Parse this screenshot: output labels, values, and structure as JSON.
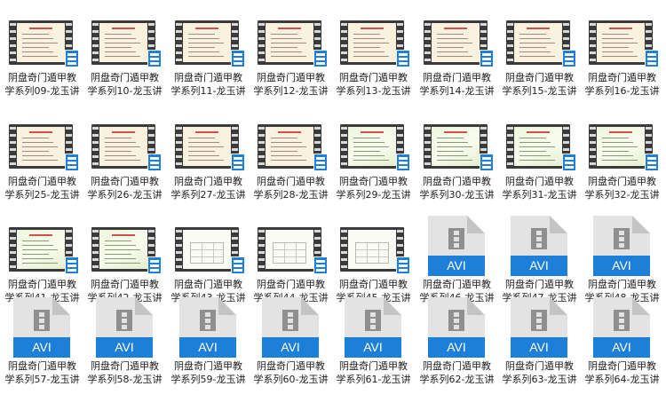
{
  "files": [
    {
      "name": "阴盘奇门遁甲教\n学系列09-龙玉讲",
      "type": "video",
      "style": "warm"
    },
    {
      "name": "阴盘奇门遁甲教\n学系列10-龙玉讲",
      "type": "video",
      "style": "warm"
    },
    {
      "name": "阴盘奇门遁甲教\n学系列11-龙玉讲",
      "type": "video",
      "style": "warm"
    },
    {
      "name": "阴盘奇门遁甲教\n学系列12-龙玉讲",
      "type": "video",
      "style": "warm"
    },
    {
      "name": "阴盘奇门遁甲教\n学系列13-龙玉讲",
      "type": "video",
      "style": "warm"
    },
    {
      "name": "阴盘奇门遁甲教\n学系列14-龙玉讲",
      "type": "video",
      "style": "warm"
    },
    {
      "name": "阴盘奇门遁甲教\n学系列15-龙玉讲",
      "type": "video",
      "style": "warm"
    },
    {
      "name": "阴盘奇门遁甲教\n学系列16-龙玉讲",
      "type": "video",
      "style": "warm"
    },
    {
      "name": "阴盘奇门遁甲教\n学系列25-龙玉讲",
      "type": "video",
      "style": "warm"
    },
    {
      "name": "阴盘奇门遁甲教\n学系列26-龙玉讲",
      "type": "video",
      "style": "warm"
    },
    {
      "name": "阴盘奇门遁甲教\n学系列27-龙玉讲",
      "type": "video",
      "style": "warm"
    },
    {
      "name": "阴盘奇门遁甲教\n学系列28-龙玉讲",
      "type": "video",
      "style": "warm"
    },
    {
      "name": "阴盘奇门遁甲教\n学系列29-龙玉讲",
      "type": "video",
      "style": "green"
    },
    {
      "name": "阴盘奇门遁甲教\n学系列30-龙玉讲",
      "type": "video",
      "style": "green"
    },
    {
      "name": "阴盘奇门遁甲教\n学系列31-龙玉讲",
      "type": "video",
      "style": "green"
    },
    {
      "name": "阴盘奇门遁甲教\n学系列32-龙玉讲",
      "type": "video",
      "style": "green"
    },
    {
      "name": "阴盘奇门遁甲教\n学系列41-龙玉讲",
      "type": "video",
      "style": "green"
    },
    {
      "name": "阴盘奇门遁甲教\n学系列42-龙玉讲",
      "type": "video",
      "style": "green"
    },
    {
      "name": "阴盘奇门遁甲教\n学系列43-龙玉讲",
      "type": "video",
      "style": "white"
    },
    {
      "name": "阴盘奇门遁甲教\n学系列44-龙玉讲",
      "type": "video",
      "style": "white"
    },
    {
      "name": "阴盘奇门遁甲教\n学系列45-龙玉讲",
      "type": "video",
      "style": "white"
    },
    {
      "name": "阴盘奇门遁甲教\n学系列46-龙玉讲",
      "type": "avi",
      "ext": "AVI"
    },
    {
      "name": "阴盘奇门遁甲教\n学系列47-龙玉讲",
      "type": "avi",
      "ext": "AVI"
    },
    {
      "name": "阴盘奇门遁甲教\n学系列48-龙玉讲",
      "type": "avi",
      "ext": "AVI"
    },
    {
      "name": "阴盘奇门遁甲教\n学系列57-龙玉讲",
      "type": "avi",
      "ext": "AVI"
    },
    {
      "name": "阴盘奇门遁甲教\n学系列58-龙玉讲",
      "type": "avi",
      "ext": "AVI"
    },
    {
      "name": "阴盘奇门遁甲教\n学系列59-龙玉讲",
      "type": "avi",
      "ext": "AVI"
    },
    {
      "name": "阴盘奇门遁甲教\n学系列60-龙玉讲",
      "type": "avi",
      "ext": "AVI"
    },
    {
      "name": "阴盘奇门遁甲教\n学系列61-龙玉讲",
      "type": "avi",
      "ext": "AVI"
    },
    {
      "name": "阴盘奇门遁甲教\n学系列62-龙玉讲",
      "type": "avi",
      "ext": "AVI"
    },
    {
      "name": "阴盘奇门遁甲教\n学系列63-龙玉讲",
      "type": "avi",
      "ext": "AVI"
    },
    {
      "name": "阴盘奇门遁甲教\n学系列64-龙玉讲",
      "type": "avi",
      "ext": "AVI"
    }
  ],
  "colors": {
    "accent": "#1e7fd9",
    "film": "#3a3a3a",
    "doc": "#e3e3e3"
  },
  "icons": {
    "video": "video-file-thumbnail-icon",
    "avi": "avi-file-icon"
  }
}
